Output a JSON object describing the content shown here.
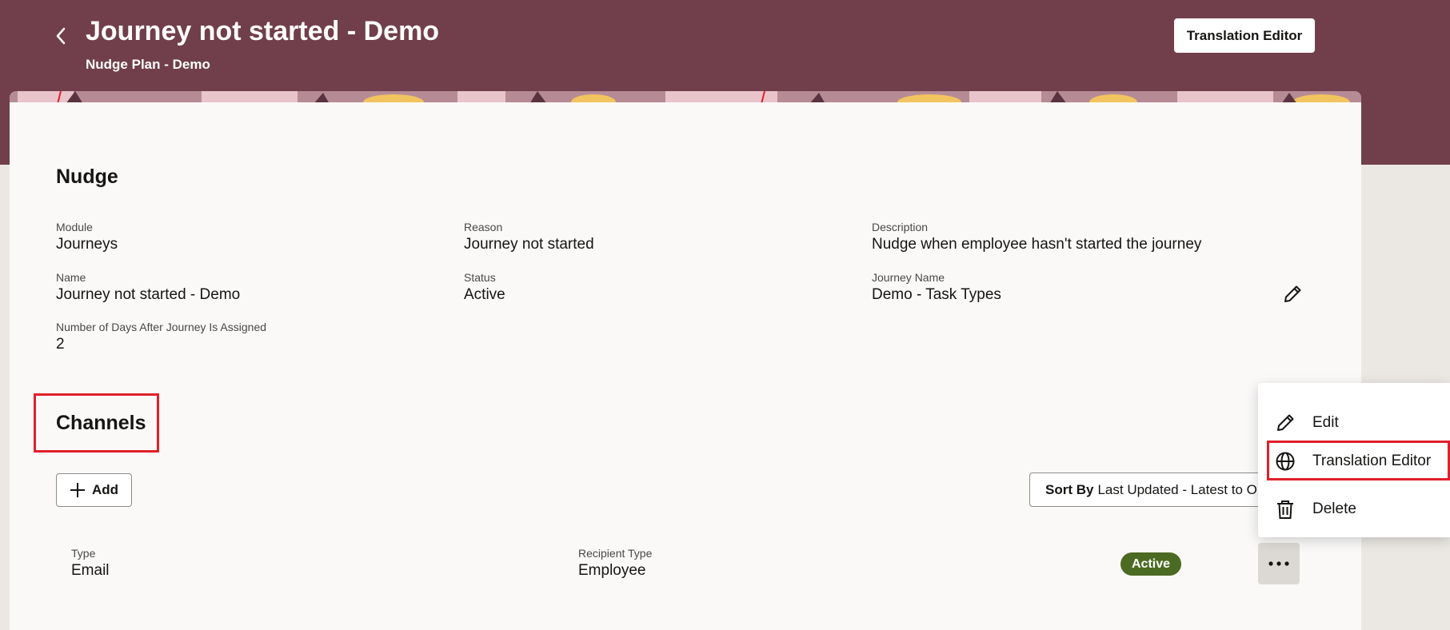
{
  "header": {
    "title": "Journey not started - Demo",
    "subtitle": "Nudge Plan - Demo",
    "translation_editor_button": "Translation Editor",
    "background_color": "#713f4b"
  },
  "nudge": {
    "section_title": "Nudge",
    "fields": {
      "module": {
        "label": "Module",
        "value": "Journeys"
      },
      "reason": {
        "label": "Reason",
        "value": "Journey not started"
      },
      "description": {
        "label": "Description",
        "value": "Nudge when employee hasn't started the journey"
      },
      "name": {
        "label": "Name",
        "value": "Journey not started - Demo"
      },
      "status": {
        "label": "Status",
        "value": "Active"
      },
      "journey_name": {
        "label": "Journey Name",
        "value": "Demo - Task Types"
      },
      "days_after": {
        "label": "Number of Days After Journey Is Assigned",
        "value": "2"
      }
    }
  },
  "channels": {
    "section_title": "Channels",
    "add_button": "Add",
    "sort": {
      "label": "Sort By",
      "value": "Last Updated - Latest to Oldest"
    },
    "rows": [
      {
        "type_label": "Type",
        "type_value": "Email",
        "recipient_label": "Recipient Type",
        "recipient_value": "Employee",
        "status": "Active"
      }
    ]
  },
  "menu": {
    "items": [
      {
        "label": "Edit",
        "icon": "pencil-icon"
      },
      {
        "label": "Translation Editor",
        "icon": "globe-icon"
      },
      {
        "label": "Delete",
        "icon": "trash-icon"
      }
    ]
  },
  "colors": {
    "highlight": "#e0202a",
    "active_badge": "#4c6b22"
  }
}
